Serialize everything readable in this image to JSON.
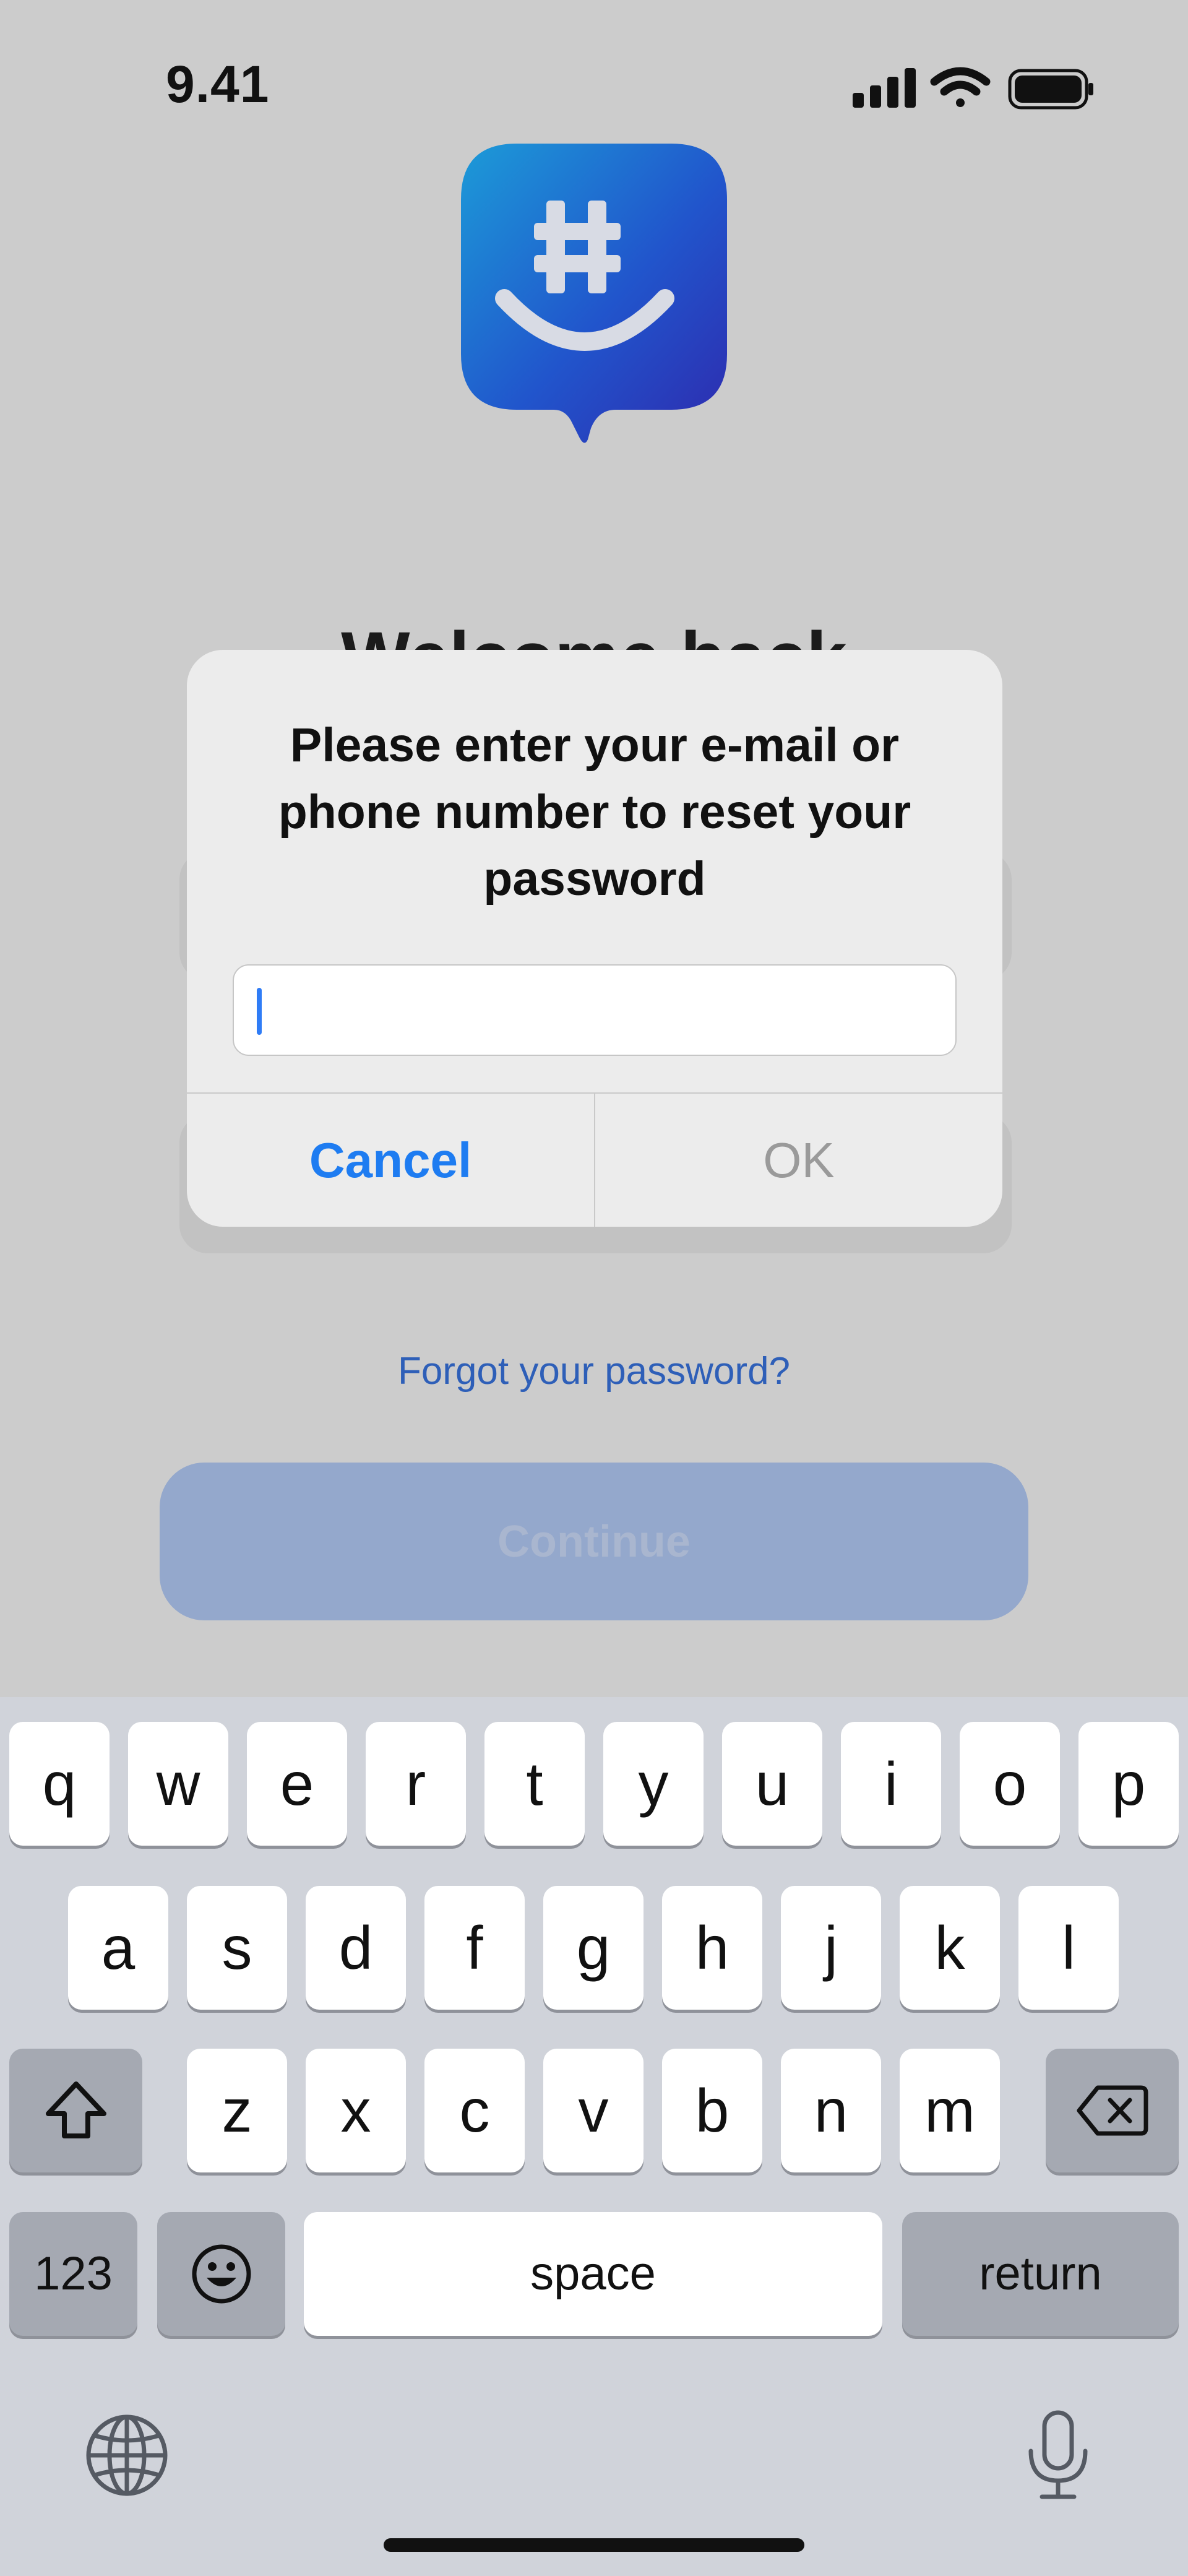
{
  "status_bar": {
    "time": "9.41"
  },
  "background": {
    "welcome_title": "Welcome back",
    "forgot_password_link": "Forgot your password?",
    "continue_button": "Continue"
  },
  "alert": {
    "title": "Please enter your e-mail or phone number to reset your password",
    "input_value": "",
    "cancel_label": "Cancel",
    "ok_label": "OK"
  },
  "keyboard": {
    "row1": [
      "q",
      "w",
      "e",
      "r",
      "t",
      "y",
      "u",
      "i",
      "o",
      "p"
    ],
    "row2": [
      "a",
      "s",
      "d",
      "f",
      "g",
      "h",
      "j",
      "k",
      "l"
    ],
    "row3": [
      "z",
      "x",
      "c",
      "v",
      "b",
      "n",
      "m"
    ],
    "numbers_key": "123",
    "space_key": "space",
    "return_key": "return",
    "icons": [
      "shift-icon",
      "backspace-icon",
      "emoji-icon",
      "globe-icon",
      "microphone-icon"
    ]
  },
  "colors": {
    "accent": "#1e7cf1",
    "app_icon_from": "#1c8fd6",
    "app_icon_to": "#2e2fb8"
  }
}
